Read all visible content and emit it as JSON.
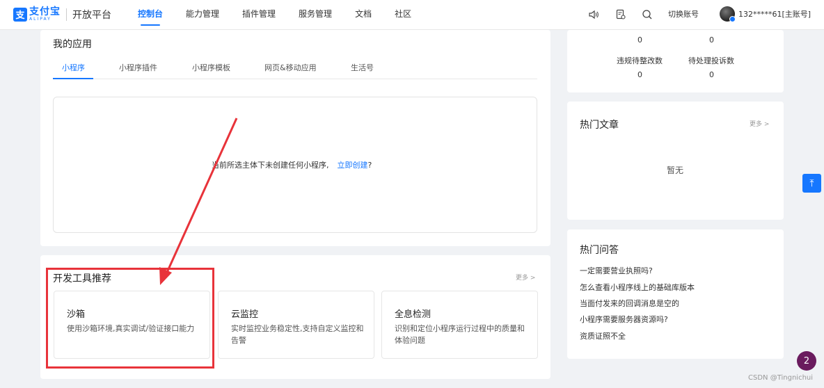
{
  "header": {
    "logo_mark": "支",
    "logo_cn": "支付宝",
    "logo_en": "ALIPAY",
    "platform": "开放平台",
    "nav": [
      "控制台",
      "能力管理",
      "插件管理",
      "服务管理",
      "文档",
      "社区"
    ],
    "active_nav": "控制台",
    "switch_account": "切换账号",
    "user": "132*****61[主账号]"
  },
  "my_apps": {
    "title": "我的应用",
    "tabs": [
      "小程序",
      "小程序插件",
      "小程序模板",
      "网页&移动应用",
      "生活号"
    ],
    "active_tab": "小程序",
    "empty_message": "当前所选主体下未创建任何小程序,",
    "create_link": "立即创建",
    "question_mark": "?"
  },
  "dev_tools": {
    "title": "开发工具推荐",
    "more": "更多 >",
    "tools": [
      {
        "name": "沙箱",
        "desc": "使用沙箱环境,真实调试/验证接口能力"
      },
      {
        "name": "云监控",
        "desc": "实时监控业务稳定性,支持自定义监控和告警"
      },
      {
        "name": "全息检测",
        "desc": "识别和定位小程序运行过程中的质量和体验问题"
      }
    ]
  },
  "stats": {
    "top_values": [
      "0",
      "0"
    ],
    "labels": [
      "违规待整改数",
      "待处理投诉数"
    ],
    "bottom_values": [
      "0",
      "0"
    ]
  },
  "hot_articles": {
    "title": "热门文章",
    "more": "更多 >",
    "empty": "暂无"
  },
  "hot_qa": {
    "title": "热门问答",
    "items": [
      "一定需要营业执照吗?",
      "怎么查看小程序线上的基础库版本",
      "当面付发来的回调消息是空的",
      "小程序需要服务器资源吗?",
      "资质证照不全"
    ]
  },
  "floating": {
    "back_top": "⤒",
    "badge": "2",
    "watermark": "CSDN @Tingnichui"
  },
  "colors": {
    "brand": "#1677ff",
    "annotation": "#e8333a",
    "badge": "#6a1b5e"
  }
}
